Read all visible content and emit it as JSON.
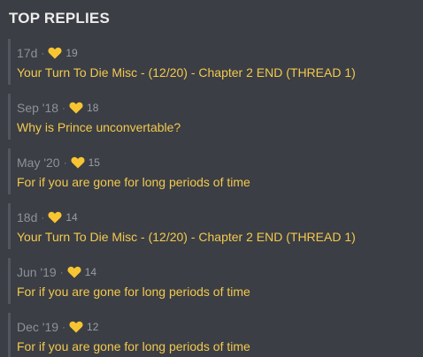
{
  "heading": "TOP REPLIES",
  "colors": {
    "background": "#3b3e44",
    "accent": "#f3c94f",
    "heart": "#f7c531",
    "meta": "#8d9199"
  },
  "replies": [
    {
      "date": "17d",
      "likes": "19",
      "title": "Your Turn To Die Misc - (12/20) - Chapter 2 END (THREAD 1)"
    },
    {
      "date": "Sep '18",
      "likes": "18",
      "title": "Why is Prince unconvertable?"
    },
    {
      "date": "May '20",
      "likes": "15",
      "title": "For if you are gone for long periods of time"
    },
    {
      "date": "18d",
      "likes": "14",
      "title": "Your Turn To Die Misc - (12/20) - Chapter 2 END (THREAD 1)"
    },
    {
      "date": "Jun '19",
      "likes": "14",
      "title": "For if you are gone for long periods of time"
    },
    {
      "date": "Dec '19",
      "likes": "12",
      "title": "For if you are gone for long periods of time"
    }
  ],
  "icons": {
    "separator": "·",
    "like": "heart-icon"
  }
}
